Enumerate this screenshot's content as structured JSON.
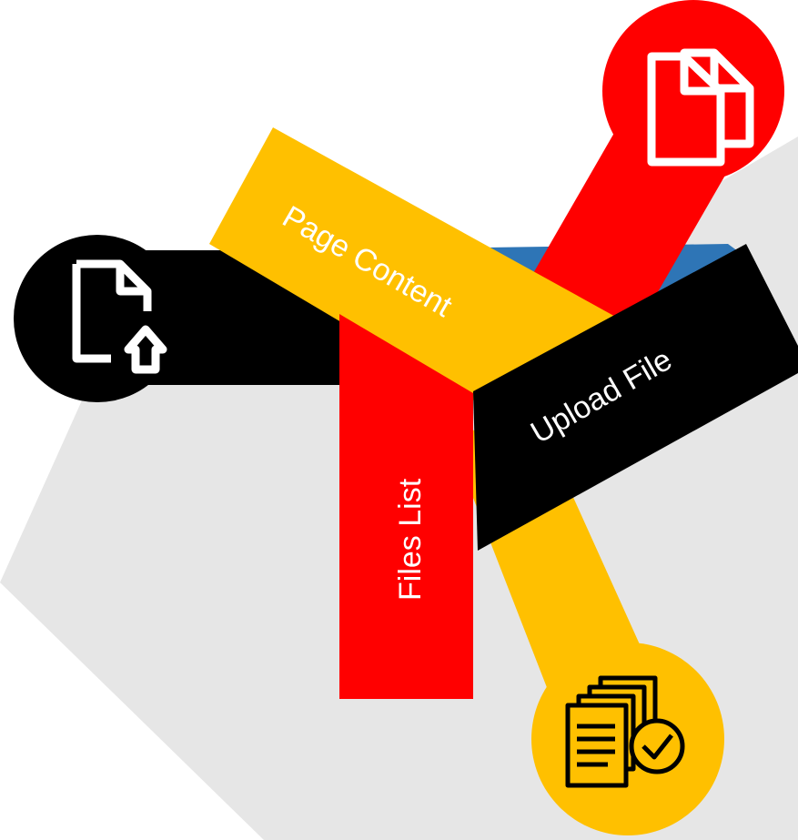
{
  "labels": {
    "page_content": "Page Content",
    "upload_file": "Upload File",
    "files_list": "Files List"
  },
  "colors": {
    "red": "#ff0000",
    "yellow": "#ffc000",
    "black": "#000000",
    "blue": "#2e75b6",
    "shadow": "#e6e6e6",
    "icon_stroke": "#ffffff"
  },
  "icons": [
    "documents-icon",
    "file-upload-icon",
    "files-checklist-icon"
  ]
}
